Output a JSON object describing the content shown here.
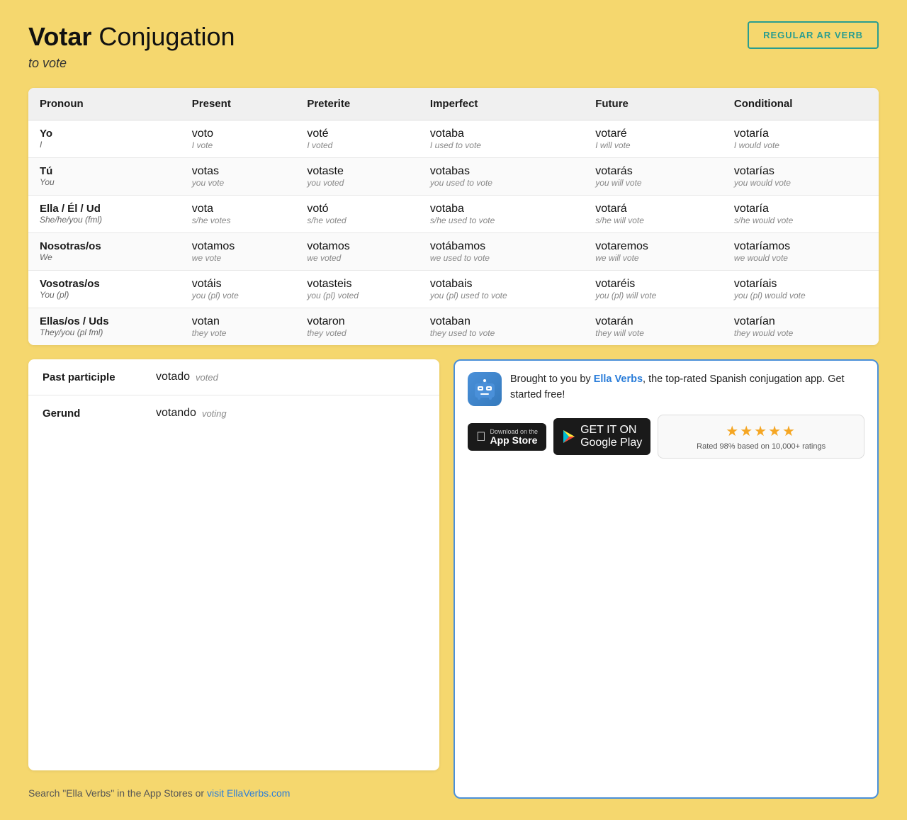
{
  "header": {
    "title_bold": "Votar",
    "title_rest": " Conjugation",
    "subtitle": "to vote",
    "verb_badge": "REGULAR AR VERB"
  },
  "table": {
    "columns": [
      "Pronoun",
      "Present",
      "Preterite",
      "Imperfect",
      "Future",
      "Conditional"
    ],
    "rows": [
      {
        "pronoun": "Yo",
        "pronoun_trans": "I",
        "present": "voto",
        "present_trans": "I vote",
        "preterite": "voté",
        "preterite_trans": "I voted",
        "imperfect": "votaba",
        "imperfect_trans": "I used to vote",
        "future": "votaré",
        "future_trans": "I will vote",
        "conditional": "votaría",
        "conditional_trans": "I would vote"
      },
      {
        "pronoun": "Tú",
        "pronoun_trans": "You",
        "present": "votas",
        "present_trans": "you vote",
        "preterite": "votaste",
        "preterite_trans": "you voted",
        "imperfect": "votabas",
        "imperfect_trans": "you used to vote",
        "future": "votarás",
        "future_trans": "you will vote",
        "conditional": "votarías",
        "conditional_trans": "you would vote"
      },
      {
        "pronoun": "Ella / Él / Ud",
        "pronoun_trans": "She/he/you (fml)",
        "present": "vota",
        "present_trans": "s/he votes",
        "preterite": "votó",
        "preterite_trans": "s/he voted",
        "imperfect": "votaba",
        "imperfect_trans": "s/he used to vote",
        "future": "votará",
        "future_trans": "s/he will vote",
        "conditional": "votaría",
        "conditional_trans": "s/he would vote"
      },
      {
        "pronoun": "Nosotras/os",
        "pronoun_trans": "We",
        "present": "votamos",
        "present_trans": "we vote",
        "preterite": "votamos",
        "preterite_trans": "we voted",
        "imperfect": "votábamos",
        "imperfect_trans": "we used to vote",
        "future": "votaremos",
        "future_trans": "we will vote",
        "conditional": "votaríamos",
        "conditional_trans": "we would vote"
      },
      {
        "pronoun": "Vosotras/os",
        "pronoun_trans": "You (pl)",
        "present": "votáis",
        "present_trans": "you (pl) vote",
        "preterite": "votasteis",
        "preterite_trans": "you (pl) voted",
        "imperfect": "votabais",
        "imperfect_trans": "you (pl) used to vote",
        "future": "votaréis",
        "future_trans": "you (pl) will vote",
        "conditional": "votaríais",
        "conditional_trans": "you (pl) would vote"
      },
      {
        "pronoun": "Ellas/os / Uds",
        "pronoun_trans": "They/you (pl fml)",
        "present": "votan",
        "present_trans": "they vote",
        "preterite": "votaron",
        "preterite_trans": "they voted",
        "imperfect": "votaban",
        "imperfect_trans": "they used to vote",
        "future": "votarán",
        "future_trans": "they will vote",
        "conditional": "votarían",
        "conditional_trans": "they would vote"
      }
    ]
  },
  "participles": {
    "past_label": "Past participle",
    "past_value": "votado",
    "past_trans": "voted",
    "gerund_label": "Gerund",
    "gerund_value": "votando",
    "gerund_trans": "voting"
  },
  "search_text": "Search \"Ella Verbs\" in the App Stores or",
  "visit_link_text": "visit EllaVerbs.com",
  "visit_link_url": "https://ellaverbs.com",
  "promo": {
    "text_before_link": "Brought to you by ",
    "link_text": "Ella Verbs",
    "link_url": "https://ellaverbs.com",
    "text_after_link": ", the top-rated Spanish conjugation app. Get started free!",
    "app_store_label_small": "Download on the",
    "app_store_label_big": "App Store",
    "google_play_label_small": "GET IT ON",
    "google_play_label_big": "Google Play",
    "rating_text": "Rated 98% based on 10,000+ ratings",
    "stars": "★★★★★"
  }
}
